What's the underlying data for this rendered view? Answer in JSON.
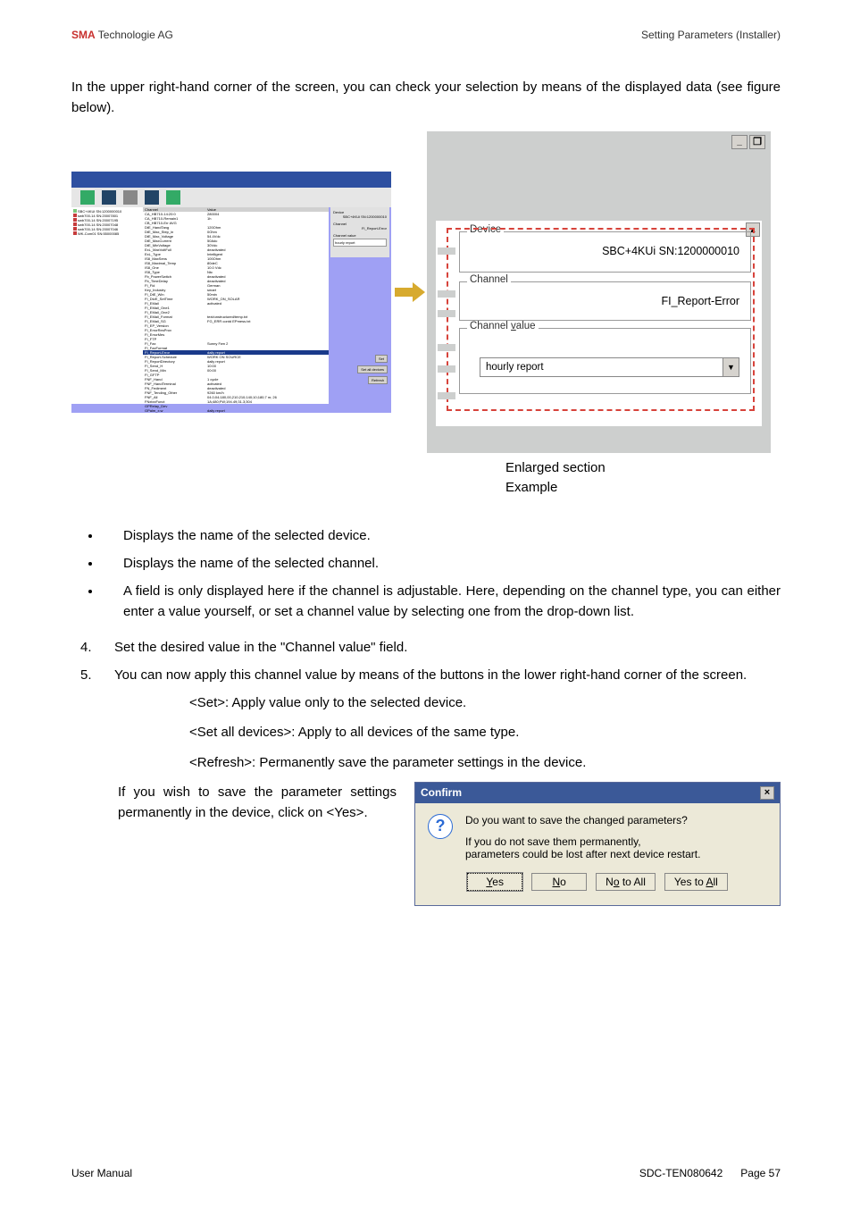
{
  "header": {
    "brand": "SMA",
    "brand_rest": " Technologie AG",
    "right": "Setting Parameters (Installer)"
  },
  "intro": "In the upper right-hand corner of the screen, you can check your selection by means of the displayed data (see figure below).",
  "screenshot": {
    "tree_items": [
      {
        "color": "#7cc67c",
        "label": "SBC+4KUi SN:1200000010"
      },
      {
        "color": "#c63b3b",
        "label": "swb700-14 SN:20007801"
      },
      {
        "color": "#c63b3b",
        "label": "swb700-14 SN:20007195"
      },
      {
        "color": "#c63b3b",
        "label": "swb700-14 SN:20007048"
      },
      {
        "color": "#c63b3b",
        "label": "swb700-14 SN:20007046"
      },
      {
        "color": "#c63b3b",
        "label": "WK-Com01 SN:55000085"
      }
    ],
    "grid_headers": {
      "c1": "Channel",
      "c2": "Value"
    },
    "grid_rows": [
      {
        "c1": "CA_HB710-14:20:0",
        "c2": "280004"
      },
      {
        "c1": "CA_HB710-Remain1",
        "c2": "1h"
      },
      {
        "c1": "CB_HB710-Err AVG",
        "c2": ""
      },
      {
        "c1": "DtE_HandTang",
        "c2": "120Ohm"
      },
      {
        "c1": "DtE_Max_Step_in",
        "c2": "0Ohm"
      },
      {
        "c1": "DtE_Max_Voltage",
        "c2": "54.4Vdc"
      },
      {
        "c1": "DtE_MaxCurrent",
        "c2": "50Adc"
      },
      {
        "c1": "DtE_MinVoltage",
        "c2": "30Vdc"
      },
      {
        "c1": "ExL_MaxVoltFull",
        "c2": "deactivated"
      },
      {
        "c1": "ExL_Type",
        "c2": "Intelligent"
      },
      {
        "c1": "IS8_MaxSens",
        "c2": "100Ohm"
      },
      {
        "c1": "IS8_Maximal_Temp",
        "c2": "80deC"
      },
      {
        "c1": "IS8_One",
        "c2": "10.0 Vdc"
      },
      {
        "c1": "IS8_Type",
        "c2": "Ntc"
      },
      {
        "c1": "Fb_PowerSwitch",
        "c2": "deactivated"
      },
      {
        "c1": "Fb_TimeDelay",
        "c2": "deactivated"
      },
      {
        "c1": "FI_Fid",
        "c2": "German"
      },
      {
        "c1": "Key_Industry",
        "c2": "smart"
      },
      {
        "c1": "FI_DtE_Win",
        "c2": "50min"
      },
      {
        "c1": "FI_DtvE_SetTime",
        "c2": "WORK_ON_SOLAR"
      },
      {
        "c1": "FI_EMail",
        "c2": "activated"
      },
      {
        "c1": "FI_EMail_One1",
        "c2": ""
      },
      {
        "c1": "FI_EMail_One2",
        "c2": ""
      },
      {
        "c1": "FI_EMail_Format",
        "c2": "text/unstructured/temp.txt"
      },
      {
        "c1": "FI_EMail_SG",
        "c2": "FG_ERR contd EPmess.txt"
      },
      {
        "c1": "FI_EP_Version",
        "c2": ""
      },
      {
        "c1": "FI_ErrorResProv",
        "c2": ""
      },
      {
        "c1": "FI_ErrorMes",
        "c2": ""
      },
      {
        "c1": "FI_FTP",
        "c2": ""
      },
      {
        "c1": "FI_Fax",
        "c2": "Sunny Fwn 2"
      },
      {
        "c1": "FI_FaxFormat",
        "c2": ""
      },
      {
        "c1": "FI_Report-Error",
        "c2": "daily report",
        "sel": true
      },
      {
        "c1": "FI_Report-Schedule",
        "c2": "WORK ON SOURCE"
      },
      {
        "c1": "FI_ReportDirectory",
        "c2": "daily report"
      },
      {
        "c1": "FI_Send_H",
        "c2": "10:00"
      },
      {
        "c1": "FI_Send_Min",
        "c2": "00:00"
      },
      {
        "c1": "FI_GFTP",
        "c2": ""
      },
      {
        "c1": "FNF_Hand",
        "c2": "1 cycle"
      },
      {
        "c1": "FNF_HandTerminal",
        "c2": "activated"
      },
      {
        "c1": "FN_Fediment",
        "c2": "deactivated"
      },
      {
        "c1": "FNF_Tending_Other",
        "c2": "9260 km/h"
      },
      {
        "c1": "FNF_All",
        "c2": "04.0;04;180,00,210;210;140;10;180;7 m; 26"
      },
      {
        "c1": "FNxtxxFunct",
        "c2": "1A;480;FW;194.49;31.3;304"
      },
      {
        "c1": "GPRelay_Dev",
        "c2": ""
      },
      {
        "c1": "GPalm_x.w",
        "c2": "daily report"
      }
    ],
    "right_panel": {
      "device_label": "Device",
      "device_value": "SBC+4KUi SN:1200000010",
      "channel_label": "Channel",
      "channel_value": "FI_Report-Error",
      "cvalue_label": "Channel value",
      "cvalue_value": "hourly report"
    },
    "buttons": {
      "set": "Set",
      "set_all": "Set all devices",
      "refresh": "Refresh"
    }
  },
  "enlarged": {
    "device_label": "Device",
    "device_value": "SBC+4KUi SN:1200000010",
    "channel_label": "Channel",
    "channel_value": "FI_Report-Error",
    "cvalue_label": "Channel value",
    "cvalue_value": "hourly report"
  },
  "caption": {
    "l1": "Enlarged section",
    "l2": "Example"
  },
  "bullets": [
    "Displays the name of the selected device.",
    "Displays the name of the selected channel.",
    "A field is only displayed here if the channel is adjustable. Here, depending on the channel type, you can either enter a value yourself, or set a channel value by selecting one from the drop-down list."
  ],
  "steps": {
    "s4": {
      "n": "4.",
      "t": "Set the desired value in the \"Channel value\" field."
    },
    "s5": {
      "n": "5.",
      "t": "You can now apply this channel value by means of the buttons in the lower right-hand corner of the screen."
    }
  },
  "subs": {
    "set": "<Set>: Apply value only to the selected device.",
    "setall": "<Set all devices>: Apply to all devices of the same type.",
    "refresh": "<Refresh>: Permanently save the parameter settings in the device.",
    "save": "If you wish to save the parameter settings permanently in the device, click on <Yes>."
  },
  "confirm": {
    "title": "Confirm",
    "msg1": "Do you want to save the changed parameters?",
    "msg2": "If you do not save them permanently,\nparameters could be lost after next device restart.",
    "btns": {
      "yes": "Yes",
      "no": "No",
      "noall": "No to All",
      "yesall": "Yes to All"
    }
  },
  "footer": {
    "left": "User Manual",
    "mid": "SDC-TEN080642",
    "page_label": "Page ",
    "page": "57"
  }
}
